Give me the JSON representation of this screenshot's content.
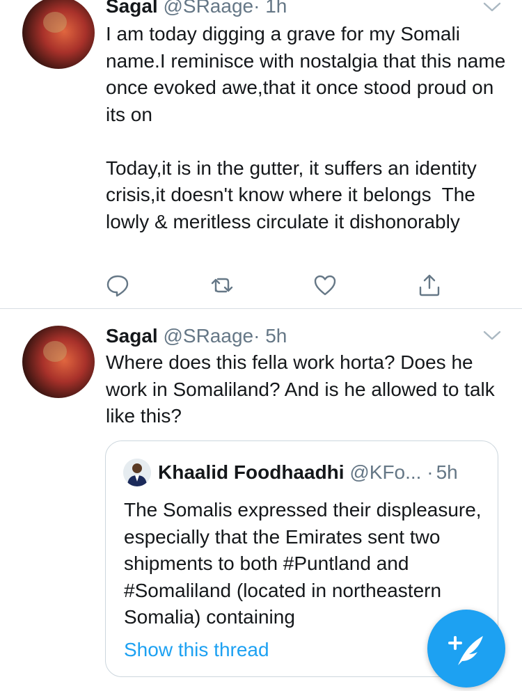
{
  "tweets": [
    {
      "name": "Sagal",
      "handle": "@SRaage",
      "dot": "·",
      "time": "1h",
      "text": "I am today digging a grave for my Somali name.I reminisce with nostalgia that this name once evoked awe,that it once stood proud on its on\n\nToday,it is in the gutter, it suffers an identity crisis,it doesn't know where it belongs  The lowly & meritless circulate it dishonorably"
    },
    {
      "name": "Sagal",
      "handle": "@SRaage",
      "dot": "·",
      "time": "5h",
      "text": "Where does this fella work horta? Does he work in Somaliland? And is he allowed to talk like this?",
      "quote": {
        "name": "Khaalid Foodhaadhi",
        "handle": "@KFo...",
        "dot": "·",
        "time": "5h",
        "text": "The Somalis expressed their displeasure, especially that the Emirates sent two shipments to both #Puntland and #Somaliland (located in northeastern Somalia) containing",
        "show_thread": "Show this thread"
      }
    }
  ],
  "colors": {
    "accent": "#1da1f2",
    "secondary_text": "#657786",
    "icon_gray": "#657786",
    "divider": "#d7dde3"
  },
  "icons": [
    "reply-icon",
    "retweet-icon",
    "like-icon",
    "share-icon",
    "chevron-down-icon",
    "compose-tweet-icon"
  ]
}
